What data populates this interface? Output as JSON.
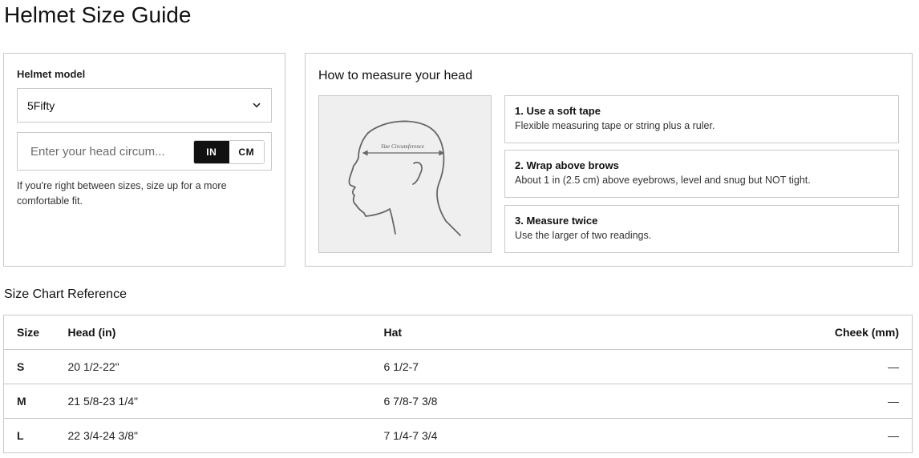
{
  "page": {
    "title": "Helmet Size Guide"
  },
  "fit_form": {
    "model_label": "Helmet model",
    "model_value": "5Fifty",
    "head_input_placeholder": "Enter your head circum...",
    "head_input_value": "",
    "units": [
      "IN",
      "CM"
    ],
    "active_unit": "IN",
    "helper_text": "If you're right between sizes, size up for a more comfortable fit."
  },
  "measure": {
    "title": "How to measure your head",
    "illustration_label": "Size Circumference",
    "steps": [
      {
        "title": "1. Use a soft tape",
        "desc": "Flexible measuring tape or string plus a ruler."
      },
      {
        "title": "2. Wrap above brows",
        "desc": "About 1 in (2.5 cm) above eyebrows, level and snug but NOT tight."
      },
      {
        "title": "3. Measure twice",
        "desc": "Use the larger of two readings."
      }
    ]
  },
  "size_chart": {
    "title": "Size Chart Reference",
    "headers": [
      "Size",
      "Head (in)",
      "Hat",
      "Cheek (mm)"
    ],
    "rows": [
      {
        "size": "S",
        "head": "20 1/2-22\"",
        "hat": "6 1/2-7",
        "cheek": "—"
      },
      {
        "size": "M",
        "head": "21 5/8-23 1/4\"",
        "hat": "6 7/8-7 3/8",
        "cheek": "—"
      },
      {
        "size": "L",
        "head": "22 3/4-24 3/8\"",
        "hat": "7 1/4-7 3/4",
        "cheek": "—"
      }
    ]
  },
  "colors": {
    "border": "#c9c9c9",
    "active_toggle_bg": "#111111",
    "illustration_bg": "#efefef"
  }
}
